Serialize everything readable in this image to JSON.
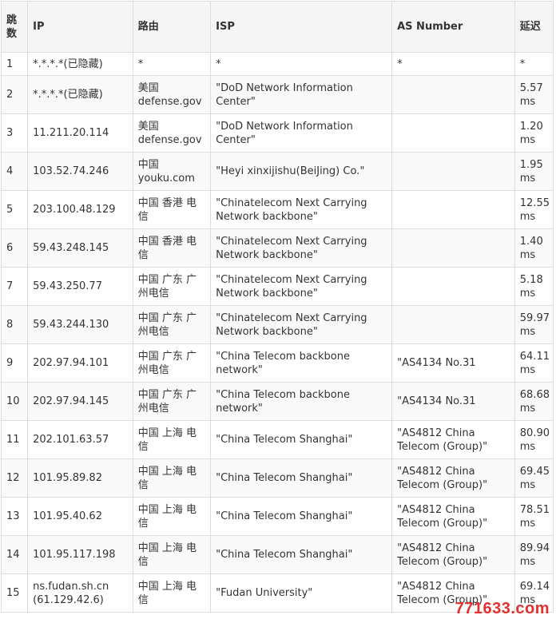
{
  "table": {
    "headers": [
      "跳数",
      "IP",
      "路由",
      "ISP",
      "AS Number",
      "延迟"
    ],
    "rows": [
      [
        "1",
        "*.*.*.*(已隐藏)",
        "*",
        "*",
        "*",
        "*"
      ],
      [
        "2",
        "*.*.*.*(已隐藏)",
        "美国 defense.gov",
        "\"DoD Network Information Center\"",
        "",
        "5.57 ms"
      ],
      [
        "3",
        "11.211.20.114",
        "美国 defense.gov",
        "\"DoD Network Information Center\"",
        "",
        "1.20 ms"
      ],
      [
        "4",
        "103.52.74.246",
        "中国 youku.com",
        "\"Heyi xinxijishu(BeiJing) Co.\"",
        "",
        "1.95 ms"
      ],
      [
        "5",
        "203.100.48.129",
        "中国 香港 电信",
        "\"Chinatelecom Next Carrying Network backbone\"",
        "",
        "12.55 ms"
      ],
      [
        "6",
        "59.43.248.145",
        "中国 香港 电信",
        "\"Chinatelecom Next Carrying Network backbone\"",
        "",
        "1.40 ms"
      ],
      [
        "7",
        "59.43.250.77",
        "中国 广东 广州电信",
        "\"Chinatelecom Next Carrying Network backbone\"",
        "",
        "5.18 ms"
      ],
      [
        "8",
        "59.43.244.130",
        "中国 广东 广州电信",
        "\"Chinatelecom Next Carrying Network backbone\"",
        "",
        "59.97 ms"
      ],
      [
        "9",
        "202.97.94.101",
        "中国 广东 广州电信",
        "\"China Telecom backbone network\"",
        "\"AS4134 No.31",
        "64.11 ms"
      ],
      [
        "10",
        "202.97.94.145",
        "中国 广东 广州电信",
        "\"China Telecom backbone network\"",
        "\"AS4134 No.31",
        "68.68 ms"
      ],
      [
        "11",
        "202.101.63.57",
        "中国 上海 电信",
        "\"China Telecom Shanghai\"",
        "\"AS4812 China Telecom (Group)\"",
        "80.90 ms"
      ],
      [
        "12",
        "101.95.89.82",
        "中国 上海 电信",
        "\"China Telecom Shanghai\"",
        "\"AS4812 China Telecom (Group)\"",
        "69.45 ms"
      ],
      [
        "13",
        "101.95.40.62",
        "中国 上海 电信",
        "\"China Telecom Shanghai\"",
        "\"AS4812 China Telecom (Group)\"",
        "78.51 ms"
      ],
      [
        "14",
        "101.95.117.198",
        "中国 上海 电信",
        "\"China Telecom Shanghai\"",
        "\"AS4812 China Telecom (Group)\"",
        "89.94 ms"
      ],
      [
        "15",
        "ns.fudan.sh.cn (61.129.42.6)",
        "中国 上海 电信",
        "\"Fudan University\"",
        "\"AS4812 China Telecom (Group)\"",
        "69.14 ms"
      ]
    ]
  },
  "watermark": "771633.com",
  "colors": {
    "header_bg": "#f5f5f5",
    "border": "#dddddd",
    "watermark": "#e0302f"
  }
}
